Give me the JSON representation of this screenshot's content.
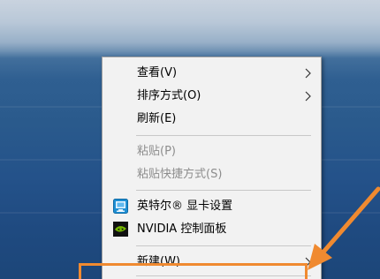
{
  "context_menu": {
    "items": [
      {
        "label": "查看(V)",
        "has_submenu": true,
        "enabled": true
      },
      {
        "label": "排序方式(O)",
        "has_submenu": true,
        "enabled": true
      },
      {
        "label": "刷新(E)",
        "has_submenu": false,
        "enabled": true
      },
      {
        "label": "粘贴(P)",
        "has_submenu": false,
        "enabled": false
      },
      {
        "label": "粘贴快捷方式(S)",
        "has_submenu": false,
        "enabled": false
      },
      {
        "label": "英特尔® 显卡设置",
        "has_submenu": false,
        "enabled": true,
        "icon": "intel-graphics-icon"
      },
      {
        "label": "NVIDIA 控制面板",
        "has_submenu": false,
        "enabled": true,
        "icon": "nvidia-icon"
      },
      {
        "label": "新建(W)",
        "has_submenu": true,
        "enabled": true
      }
    ]
  },
  "annotation": {
    "highlight_color": "#f08a30",
    "arrow_color": "#f08a30"
  }
}
